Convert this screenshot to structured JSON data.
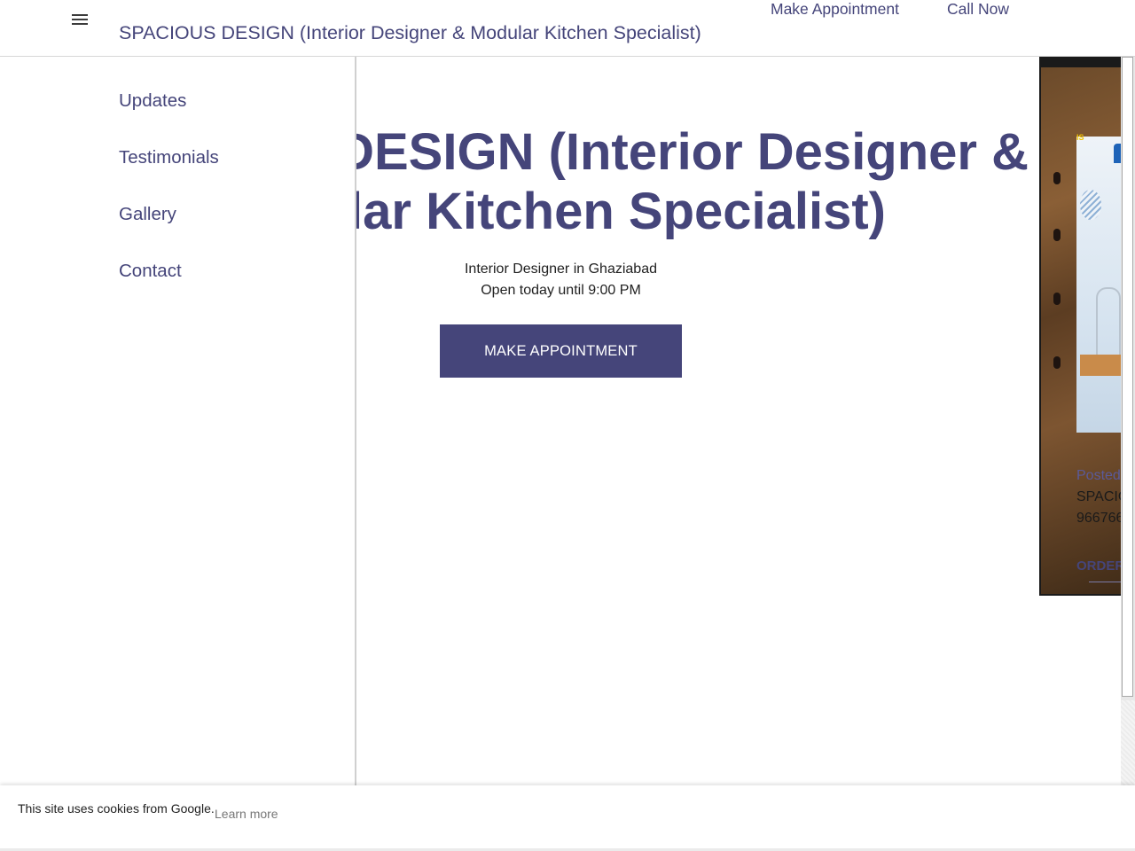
{
  "header": {
    "site_title": "SPACIOUS DESIGN (Interior Designer & Modular Kitchen Specialist)",
    "nav": {
      "make_appointment": "Make Appointment",
      "call_now": "Call Now"
    }
  },
  "drawer": {
    "items": [
      {
        "label": "Updates"
      },
      {
        "label": "Testimonials"
      },
      {
        "label": "Gallery"
      },
      {
        "label": "Contact"
      }
    ]
  },
  "hero": {
    "title_line1": "SPACIOUS DESIGN (Interior Designer &",
    "title_line2": "Modular Kitchen Specialist)",
    "category": "Interior Designer in Ghaziabad",
    "hours": "Open today until 9:00 PM",
    "cta_label": "MAKE APPOINTMENT"
  },
  "update_card": {
    "posted_label": "Posted",
    "line1": "SPACIO",
    "line2": "966766",
    "order_label": "ORDER"
  },
  "cookie_banner": {
    "text": "This site uses cookies from Google.",
    "link": "Learn more"
  },
  "colors": {
    "brand": "#45457a",
    "text": "#212121",
    "muted": "#777777"
  }
}
